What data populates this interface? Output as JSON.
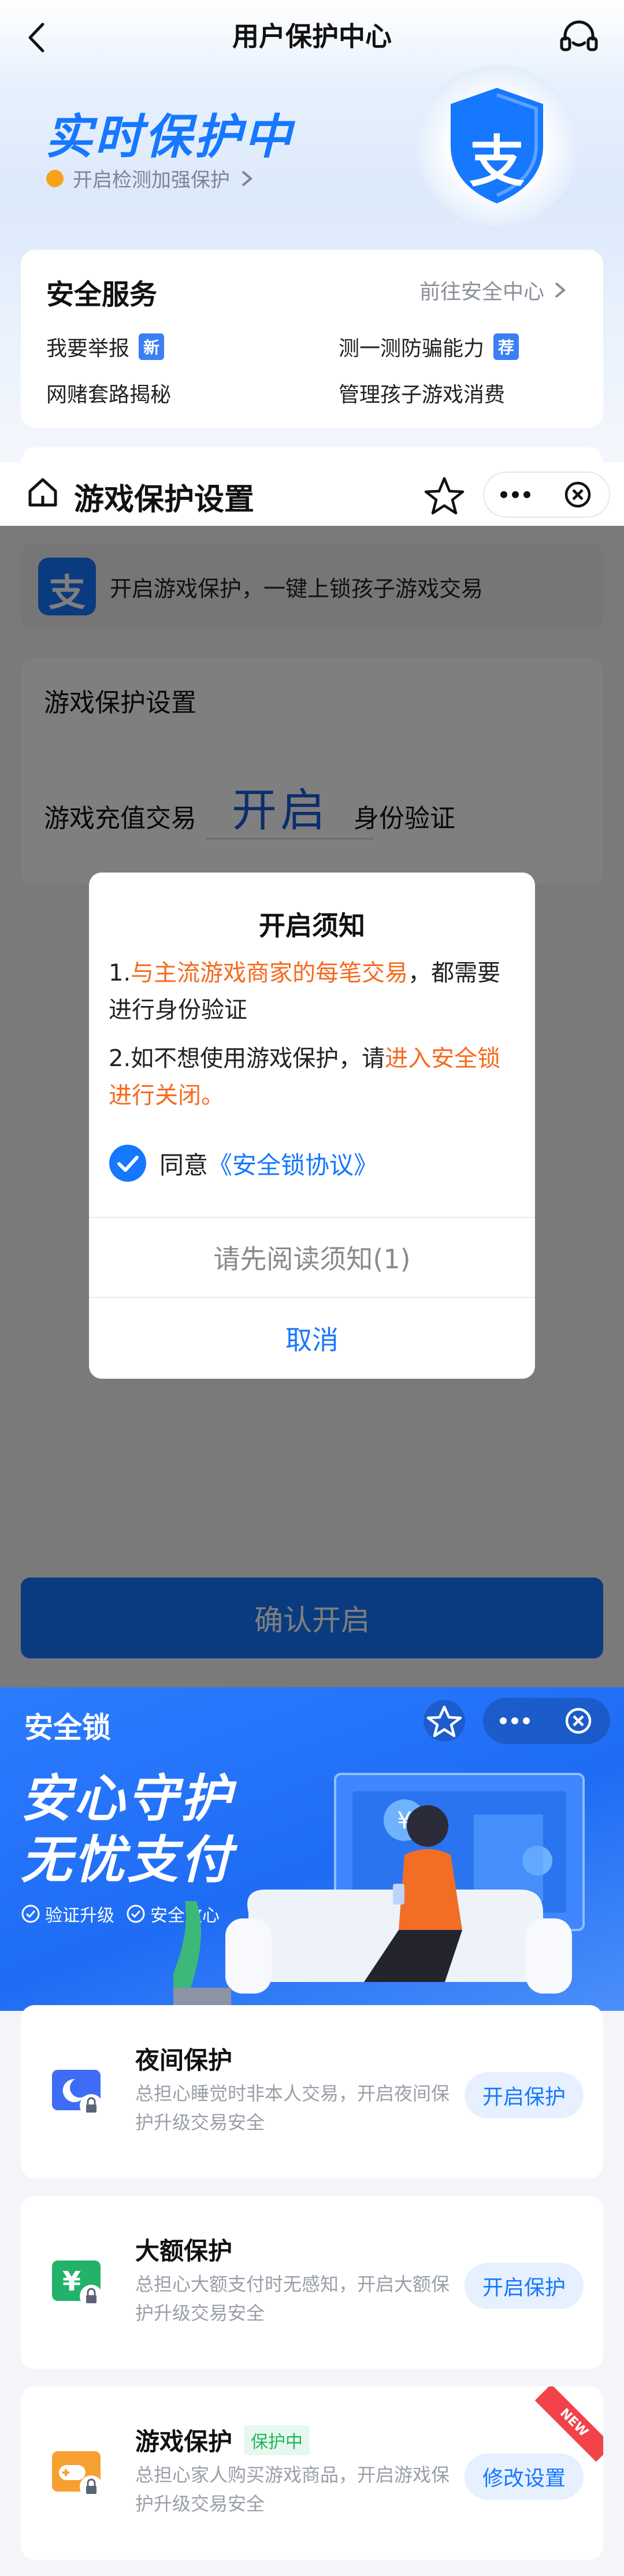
{
  "user_protection": {
    "nav_title": "用户保护中心",
    "hero_title": "实时保护中",
    "hero_hint": "开启检测加强保护",
    "logo_char": "支",
    "services": {
      "title": "安全服务",
      "link": "前往安全中心",
      "items": [
        {
          "label": "我要举报",
          "tag": "新"
        },
        {
          "label": "测一测防骗能力",
          "tag": "荐"
        },
        {
          "label": "网赌套路揭秘",
          "tag": ""
        },
        {
          "label": "管理孩子游戏消费",
          "tag": ""
        }
      ]
    }
  },
  "game_protection": {
    "nav_title": "游戏保护设置",
    "banner_text": "开启游戏保护，一键上锁孩子游戏交易",
    "logo_char": "支",
    "settings_title": "游戏保护设置",
    "row_left": "游戏充值交易",
    "row_handwritten": "开启",
    "row_right": "身份验证",
    "confirm_button": "确认开启",
    "modal": {
      "title": "开启须知",
      "p1_prefix": "1.",
      "p1_highlight": "与主流游戏商家的每笔交易",
      "p1_suffix": "，都需要进行身份验证",
      "p2_prefix": "2.如不想使用游戏保护，请",
      "p2_highlight": "进入安全锁进行关闭。",
      "agree_prefix": "同意",
      "agree_link": "《安全锁协议》",
      "read_button": "请先阅读须知(1)",
      "cancel_button": "取消"
    }
  },
  "security_lock": {
    "nav_title": "安全锁",
    "hero_title_line1": "安心守护",
    "hero_title_line2": "无忧支付",
    "badge1": "验证升级",
    "badge2": "安全放心",
    "features": [
      {
        "title": "夜间保护",
        "status": "",
        "desc": "总担心睡觉时非本人交易，开启夜间保护升级交易安全",
        "button": "开启保护",
        "icon": "moon-lock-icon",
        "color": "#3e6cf6"
      },
      {
        "title": "大额保护",
        "status": "",
        "desc": "总担心大额支付时无感知，开启大额保护升级交易安全",
        "button": "开启保护",
        "icon": "yuan-lock-icon",
        "color": "#22b26a"
      },
      {
        "title": "游戏保护",
        "status": "保护中",
        "desc": "总担心家人购买游戏商品，开启游戏保护升级交易安全",
        "button": "修改设置",
        "icon": "gamepad-lock-icon",
        "color": "#f7a032",
        "corner": "NEW"
      }
    ]
  },
  "colors": {
    "accent": "#1677ff",
    "highlight": "#f56a1d",
    "success": "#21b45c"
  }
}
